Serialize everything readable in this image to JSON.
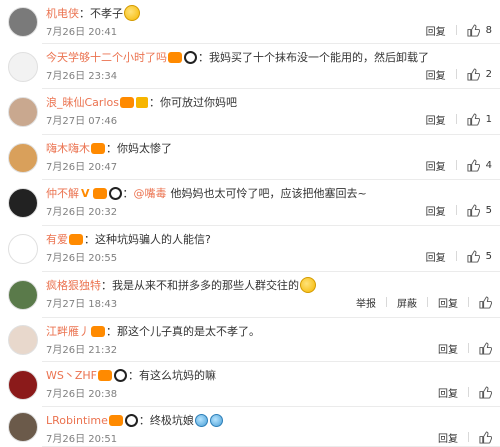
{
  "comments": [
    {
      "user": "机电侠",
      "text": "不孝子",
      "emoji_after": [
        "grin"
      ],
      "mention": "",
      "text2": "",
      "badges": [],
      "time": "7月26日 20:41",
      "reply": "回复",
      "likes": "8",
      "extra": []
    },
    {
      "user": "今天学够十二个小时了吗",
      "text": "我妈买了十个抹布没一个能用的，然后卸载了",
      "badges": [
        "lv",
        "panda"
      ],
      "mention": "",
      "text2": "",
      "emoji_after": [],
      "time": "7月26日 23:34",
      "reply": "回复",
      "likes": "2",
      "extra": []
    },
    {
      "user": "浪_昧仙Carlos",
      "text": "你可放过你妈吧",
      "badges": [
        "lv",
        "crown"
      ],
      "mention": "",
      "text2": "",
      "emoji_after": [],
      "time": "7月27日 07:46",
      "reply": "回复",
      "likes": "1",
      "extra": []
    },
    {
      "user": "嗨木嗨木",
      "text": "你妈太惨了",
      "badges": [
        "lv"
      ],
      "mention": "",
      "text2": "",
      "emoji_after": [],
      "time": "7月26日 20:47",
      "reply": "回复",
      "likes": "4",
      "extra": []
    },
    {
      "user": "仲不解",
      "text": "",
      "badges": [
        "vip",
        "lv",
        "panda"
      ],
      "mention": "@嘴毒",
      "text2": "他妈妈也太可怜了吧，应该把他塞回去~",
      "emoji_after": [],
      "time": "7月26日 20:32",
      "reply": "回复",
      "likes": "5",
      "extra": []
    },
    {
      "user": "有爱",
      "text": "这种坑妈骗人的人能信?",
      "badges": [
        "lv"
      ],
      "mention": "",
      "text2": "",
      "emoji_after": [],
      "time": "7月26日 20:55",
      "reply": "回复",
      "likes": "5",
      "extra": []
    },
    {
      "user": "疯格狠独特",
      "text": "我是从来不和拼多多的那些人群交往的",
      "badges": [],
      "mention": "",
      "text2": "",
      "emoji_after": [
        "grin"
      ],
      "time": "7月27日 18:43",
      "reply": "回复",
      "likes": "",
      "extra": [
        "举报",
        "屏蔽"
      ]
    },
    {
      "user": "江畔雁丿",
      "text": "那这个儿子真的是太不孝了。",
      "badges": [
        "lv"
      ],
      "mention": "",
      "text2": "",
      "emoji_after": [],
      "time": "7月26日 21:32",
      "reply": "回复",
      "likes": "",
      "extra": []
    },
    {
      "user": "WS丶ZHF",
      "text": "有这么坑妈的嘛",
      "badges": [
        "lv",
        "panda"
      ],
      "mention": "",
      "text2": "",
      "emoji_after": [],
      "time": "7月26日 20:38",
      "reply": "回复",
      "likes": "",
      "extra": []
    },
    {
      "user": "LRobintime",
      "text": "终极坑娘",
      "badges": [
        "lv",
        "panda"
      ],
      "mention": "",
      "text2": "",
      "emoji_after": [
        "cry",
        "cry"
      ],
      "time": "7月26日 20:51",
      "reply": "回复",
      "likes": "",
      "extra": []
    }
  ],
  "avatar_colors": [
    "#7a7a7a",
    "#f2f2f2",
    "#c9a88f",
    "#d9a05b",
    "#222222",
    "#ffffff",
    "#5a7a4a",
    "#e8d8cc",
    "#8b1a1a",
    "#6b5a4a"
  ],
  "accent_color": "#eb7350"
}
